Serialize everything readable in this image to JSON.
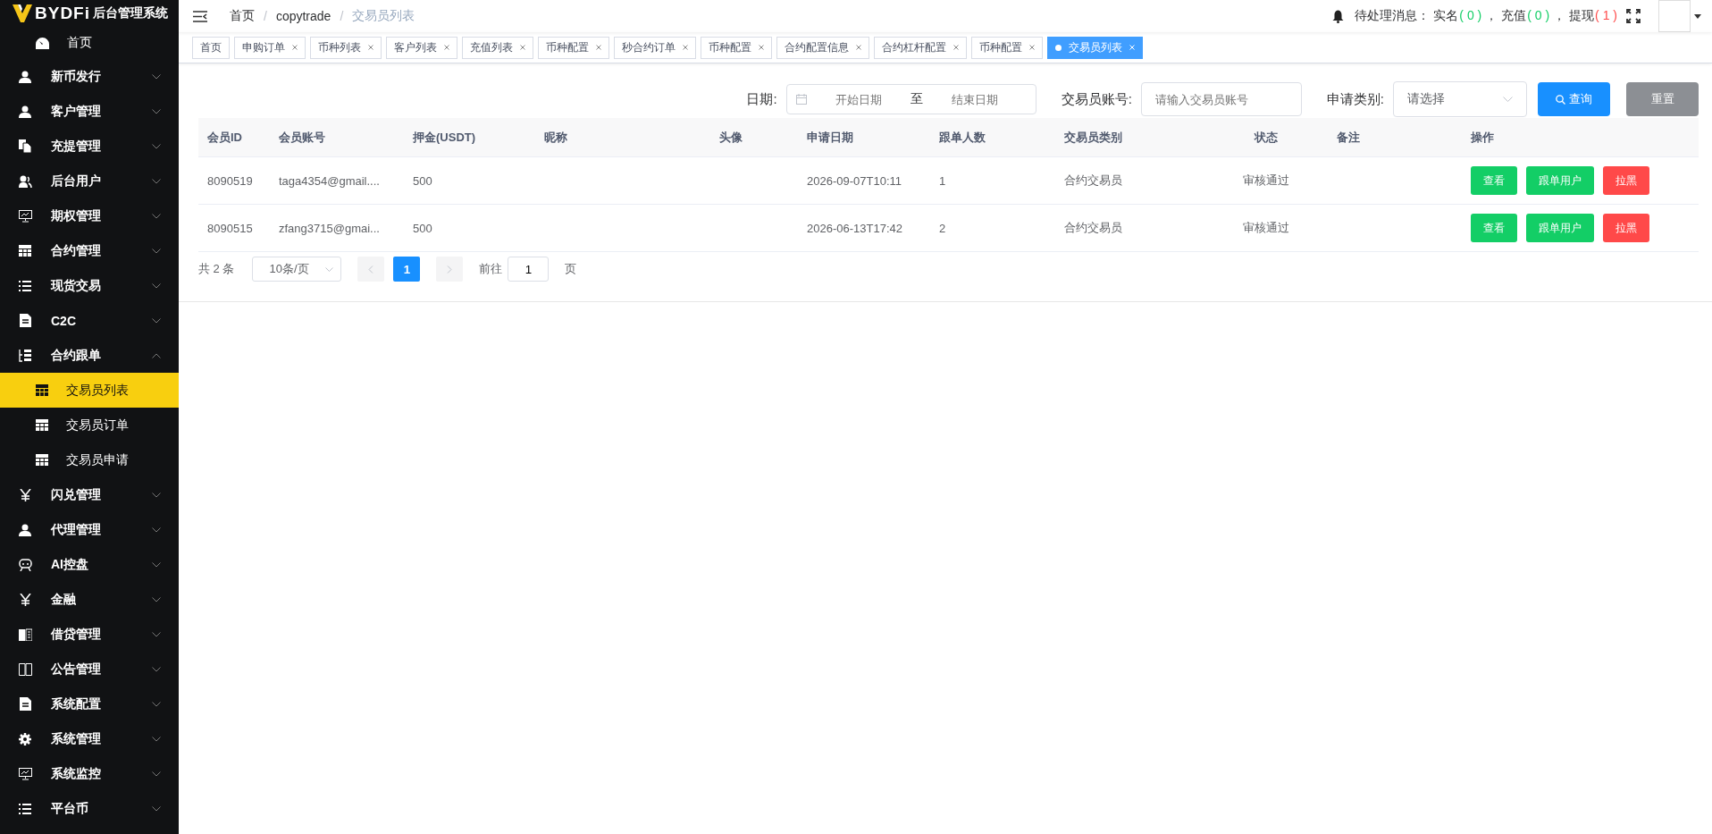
{
  "logo": {
    "brand": "BYDFi",
    "title": "后台管理系统"
  },
  "sidebar": {
    "home": {
      "label": "首页",
      "selected": false
    },
    "items": [
      {
        "label": "新币发行",
        "expanded": false
      },
      {
        "label": "客户管理",
        "expanded": false
      },
      {
        "label": "充提管理",
        "expanded": false
      },
      {
        "label": "后台用户",
        "expanded": false
      },
      {
        "label": "期权管理",
        "expanded": false
      },
      {
        "label": "合约管理",
        "expanded": false
      },
      {
        "label": "现货交易",
        "expanded": false
      },
      {
        "label": "C2C",
        "expanded": false
      },
      {
        "label": "合约跟单",
        "expanded": true,
        "children": [
          {
            "label": "交易员列表",
            "selected": true
          },
          {
            "label": "交易员订单",
            "selected": false
          },
          {
            "label": "交易员申请",
            "selected": false
          }
        ]
      },
      {
        "label": "闪兑管理",
        "expanded": false
      },
      {
        "label": "代理管理",
        "expanded": false
      },
      {
        "label": "AI控盘",
        "expanded": false
      },
      {
        "label": "金融",
        "expanded": false
      },
      {
        "label": "借贷管理",
        "expanded": false
      },
      {
        "label": "公告管理",
        "expanded": false
      },
      {
        "label": "系统配置",
        "expanded": false
      },
      {
        "label": "系统管理",
        "expanded": false
      },
      {
        "label": "系统监控",
        "expanded": false
      },
      {
        "label": "平台币",
        "expanded": false
      }
    ]
  },
  "breadcrumb": [
    {
      "label": "首页"
    },
    {
      "separator": "/",
      "label": "copytrade"
    },
    {
      "separator": "/",
      "label": "交易员列表"
    }
  ],
  "notice": {
    "label": "待处理消息：",
    "items": [
      {
        "label": "实名",
        "count": "( 0 )",
        "color": "#13ce66"
      },
      {
        "separator": "，",
        "label": "充值",
        "count": "( 0 )",
        "color": "#13ce66"
      },
      {
        "separator": "，",
        "label": "提现",
        "count": "( 1 )",
        "color": "#ff4949"
      }
    ]
  },
  "tabs": [
    {
      "label": "首页",
      "selected": false,
      "closable": false
    },
    {
      "label": "申购订单",
      "selected": false,
      "closable": true
    },
    {
      "label": "币种列表",
      "selected": false,
      "closable": true
    },
    {
      "label": "客户列表",
      "selected": false,
      "closable": true
    },
    {
      "label": "充值列表",
      "selected": false,
      "closable": true
    },
    {
      "label": "币种配置",
      "selected": false,
      "closable": true
    },
    {
      "label": "秒合约订单",
      "selected": false,
      "closable": true
    },
    {
      "label": "币种配置",
      "selected": false,
      "closable": true
    },
    {
      "label": "合约配置信息",
      "selected": false,
      "closable": true
    },
    {
      "label": "合约杠杆配置",
      "selected": false,
      "closable": true
    },
    {
      "label": "币种配置",
      "selected": false,
      "closable": true
    },
    {
      "label": "交易员列表",
      "selected": true,
      "closable": true
    }
  ],
  "filters": {
    "date": {
      "label": "日期:",
      "start_placeholder": "开始日期",
      "separator": "至",
      "end_placeholder": "结束日期"
    },
    "account": {
      "label": "交易员账号:",
      "placeholder": "请输入交易员账号"
    },
    "category": {
      "label": "申请类别:",
      "placeholder": "请选择"
    },
    "search_button": "查询",
    "reset_button": "重置"
  },
  "table": {
    "columns": [
      "会员ID",
      "会员账号",
      "押金(USDT)",
      "昵称",
      "头像",
      "申请日期",
      "跟单人数",
      "交易员类别",
      "状态",
      "备注",
      "操作"
    ],
    "rows": [
      {
        "id": "8090519",
        "account": "taga4354@gmail....",
        "deposit": "500",
        "date": "2026-09-07T10:11",
        "followers": "1",
        "type": "合约交易员",
        "status": "审核通过",
        "actions": [
          "查看",
          "跟单用户",
          "拉黑"
        ]
      },
      {
        "id": "8090515",
        "account": "zfang3715@gmai...",
        "deposit": "500",
        "date": "2026-06-13T17:42",
        "followers": "2",
        "type": "合约交易员",
        "status": "审核通过",
        "actions": [
          "查看",
          "跟单用户",
          "拉黑"
        ]
      }
    ]
  },
  "pagination": {
    "total": "共 2 条",
    "page_size": "10条/页",
    "pages": [
      {
        "label": "1",
        "selected": true
      }
    ],
    "goto_label": "前往",
    "goto_value": "1",
    "goto_suffix": "页"
  }
}
